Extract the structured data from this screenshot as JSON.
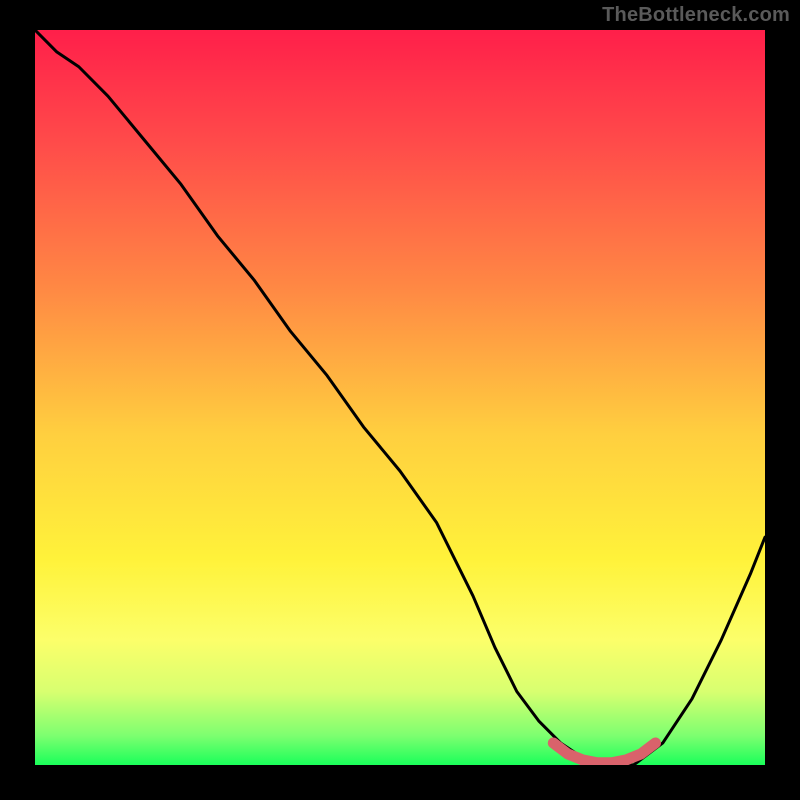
{
  "attribution": "TheBottleneck.com",
  "colors": {
    "black": "#000000",
    "attribution_text": "#5a5a5a",
    "curve_dark": "#000000",
    "highlight": "#d9626b"
  },
  "gradient_stops": [
    {
      "pct": 0,
      "color": "#ff1f4a"
    },
    {
      "pct": 15,
      "color": "#ff4a4a"
    },
    {
      "pct": 35,
      "color": "#ff8844"
    },
    {
      "pct": 55,
      "color": "#ffcf3f"
    },
    {
      "pct": 72,
      "color": "#fff23a"
    },
    {
      "pct": 83,
      "color": "#fcff6a"
    },
    {
      "pct": 90,
      "color": "#d8ff70"
    },
    {
      "pct": 96,
      "color": "#7dff70"
    },
    {
      "pct": 100,
      "color": "#1aff5a"
    }
  ],
  "chart_data": {
    "type": "line",
    "title": "",
    "xlabel": "",
    "ylabel": "",
    "xlim": [
      0,
      100
    ],
    "ylim": [
      0,
      100
    ],
    "legend": false,
    "grid": false,
    "series": [
      {
        "name": "bottleneck-curve",
        "color": "#000000",
        "x": [
          0,
          3,
          6,
          10,
          15,
          20,
          25,
          30,
          35,
          40,
          45,
          50,
          55,
          60,
          63,
          66,
          69,
          72,
          75,
          78,
          82,
          86,
          90,
          94,
          98,
          100
        ],
        "y": [
          100,
          97,
          95,
          91,
          85,
          79,
          72,
          66,
          59,
          53,
          46,
          40,
          33,
          23,
          16,
          10,
          6,
          3,
          1,
          0,
          0,
          3,
          9,
          17,
          26,
          31
        ]
      },
      {
        "name": "optimal-highlight",
        "color": "#d9626b",
        "x": [
          71,
          73,
          75,
          77,
          79,
          81,
          83,
          85
        ],
        "y": [
          3,
          1.5,
          0.7,
          0.3,
          0.3,
          0.7,
          1.5,
          3
        ]
      }
    ],
    "annotations": []
  }
}
